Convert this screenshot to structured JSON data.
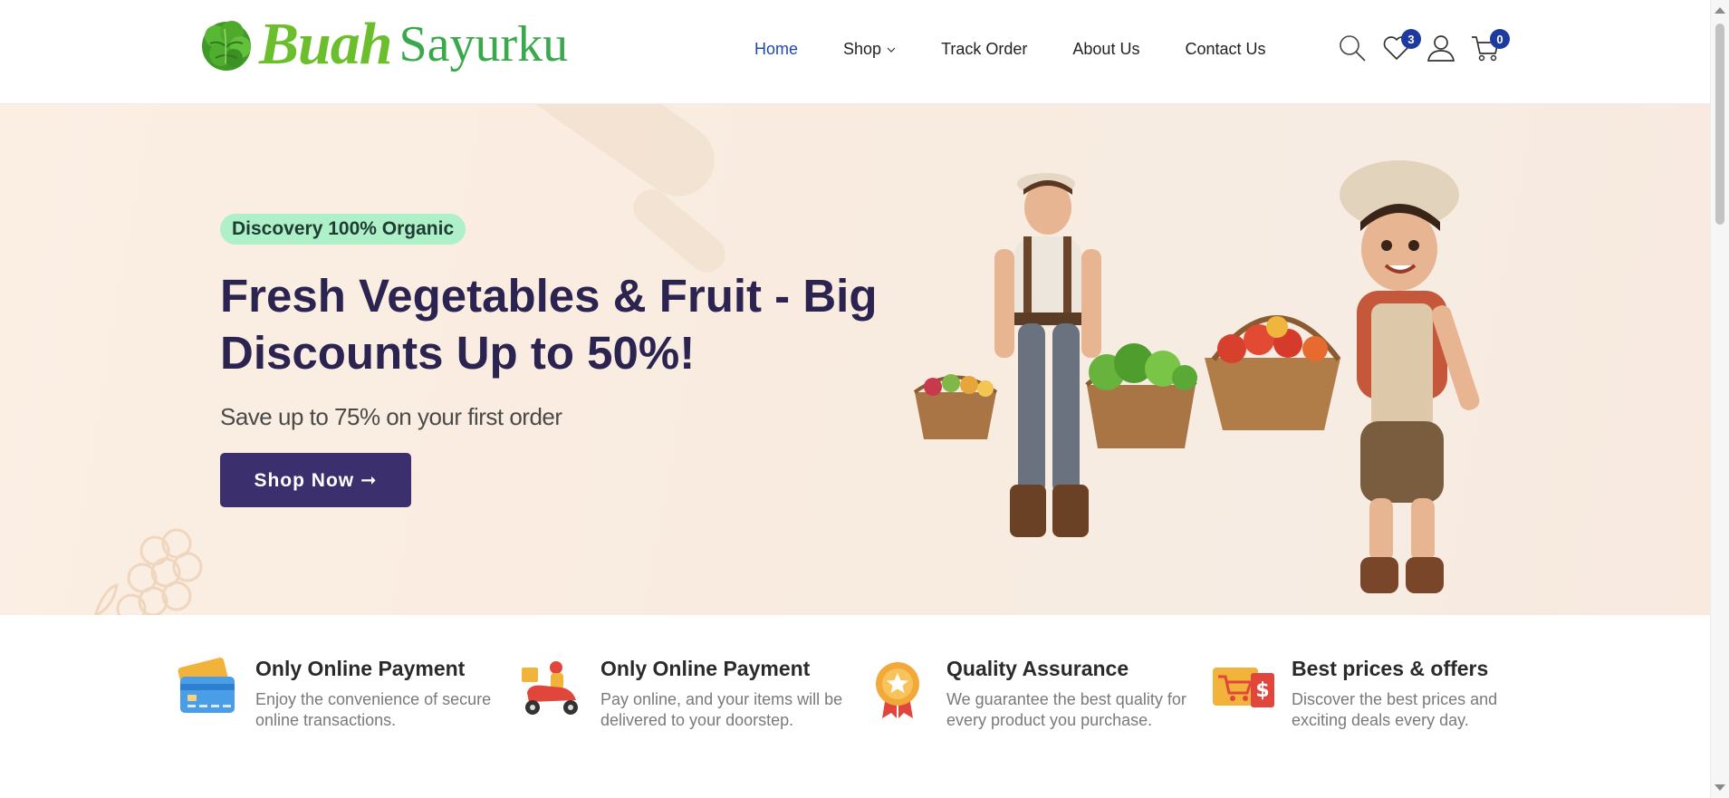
{
  "brand": {
    "name_part1": "Buah",
    "name_part2": "Sayurku",
    "primary_color": "#6cbf2c",
    "secondary_color": "#39a94b"
  },
  "nav": {
    "items": [
      {
        "label": "Home",
        "active": true
      },
      {
        "label": "Shop",
        "has_dropdown": true
      },
      {
        "label": "Track Order"
      },
      {
        "label": "About Us"
      },
      {
        "label": "Contact Us"
      }
    ],
    "active_color": "#1f48a8"
  },
  "header_icons": {
    "search": {
      "icon": "search-icon"
    },
    "wishlist": {
      "icon": "heart-icon",
      "count": "3"
    },
    "account": {
      "icon": "user-icon"
    },
    "cart": {
      "icon": "cart-icon",
      "count": "0"
    },
    "badge_color": "#1e3a9f"
  },
  "hero": {
    "tag": "Discovery 100% Organic",
    "title": "Fresh Vegetables & Fruit - Big Discounts Up to 50%!",
    "subtitle": "Save up to 75% on your first order",
    "cta_label": "Shop Now ➞",
    "tag_color": "#aef0c8",
    "title_color": "#2b2350",
    "cta_color": "#3c2f6e"
  },
  "features": [
    {
      "icon": "credit-card-icon",
      "title": "Only Online Payment",
      "desc": "Enjoy the convenience of secure online transactions."
    },
    {
      "icon": "delivery-scooter-icon",
      "title": "Only Online Payment",
      "desc": "Pay online, and your items will be delivered to your doorstep."
    },
    {
      "icon": "quality-medal-icon",
      "title": "Quality Assurance",
      "desc": "We guarantee the best quality for every product you purchase."
    },
    {
      "icon": "price-tag-icon",
      "title": "Best prices & offers",
      "desc": "Discover the best prices and exciting deals every day."
    }
  ]
}
